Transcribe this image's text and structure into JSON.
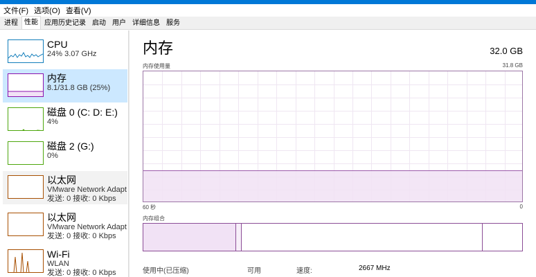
{
  "menu": [
    "文件(F)",
    "选项(O)",
    "查看(V)"
  ],
  "tabs": [
    "进程",
    "性能",
    "应用历史记录",
    "启动",
    "用户",
    "详细信息",
    "服务"
  ],
  "active_tab": 1,
  "sidebar": [
    {
      "title": "CPU",
      "sub1": "24% 3.07 GHz",
      "sub2": "",
      "color": "#117dbb",
      "selected": false
    },
    {
      "title": "内存",
      "sub1": "8.1/31.8 GB (25%)",
      "sub2": "",
      "color": "#8b12ae",
      "selected": true
    },
    {
      "title": "磁盘 0 (C: D: E:)",
      "sub1": "4%",
      "sub2": "",
      "color": "#4da60c",
      "selected": false
    },
    {
      "title": "磁盘 2 (G:)",
      "sub1": "0%",
      "sub2": "",
      "color": "#4da60c",
      "selected": false
    },
    {
      "title": "以太网",
      "sub1": "VMware Network Adapt",
      "sub2": "发送: 0 接收: 0 Kbps",
      "color": "#a74f01",
      "selected": false
    },
    {
      "title": "以太网",
      "sub1": "VMware Network Adapt",
      "sub2": "发送: 0 接收: 0 Kbps",
      "color": "#a74f01",
      "selected": false
    },
    {
      "title": "Wi-Fi",
      "sub1": "WLAN",
      "sub2": "发送: 0 接收: 0 Kbps",
      "color": "#a74f01",
      "selected": false
    }
  ],
  "main": {
    "title": "内存",
    "total": "32.0 GB",
    "usage_label": "内存使用量",
    "usage_max": "31.8 GB",
    "axis_left": "60 秒",
    "axis_right": "0",
    "usage_fraction": 0.25,
    "composition_label": "内存组合",
    "stats": {
      "in_use_label": "使用中(已压缩)",
      "available_label": "可用",
      "speed_label": "速度:",
      "speed_value": "2667 MHz"
    }
  }
}
